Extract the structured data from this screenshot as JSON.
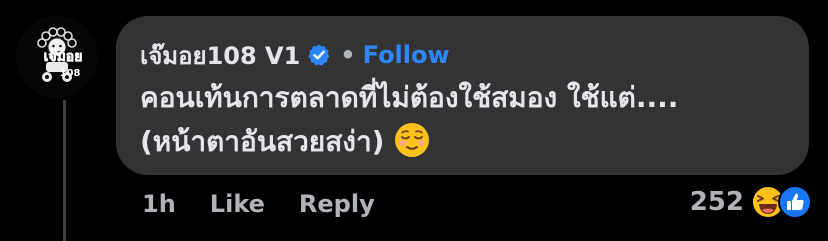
{
  "comment": {
    "author": "เจ๊มอย108 V1",
    "follow_label": "Follow",
    "separator": "•",
    "text_line1": "คอนเท้นการตลาดที่ไม่ต้องใช้สมอง ใช้แต่....",
    "text_line2": "(หน้าตาอันสวยสง่า)",
    "avatar_logo_text": "เจ๊มอย",
    "avatar_logo_number": "108"
  },
  "actions": {
    "time": "1h",
    "like_label": "Like",
    "reply_label": "Reply"
  },
  "reactions": {
    "count": "252",
    "types": [
      "haha",
      "like"
    ]
  },
  "icons": {
    "verified": "verified-badge-icon",
    "emoji": "relieved-face-emoji",
    "haha": "haha-reaction-icon",
    "like": "like-reaction-icon"
  },
  "colors": {
    "background": "#000000",
    "bubble": "#333334",
    "text": "#e4e6eb",
    "secondary_text": "#b0b3b8",
    "accent": "#2d88ff",
    "logo_red": "#e02020"
  }
}
